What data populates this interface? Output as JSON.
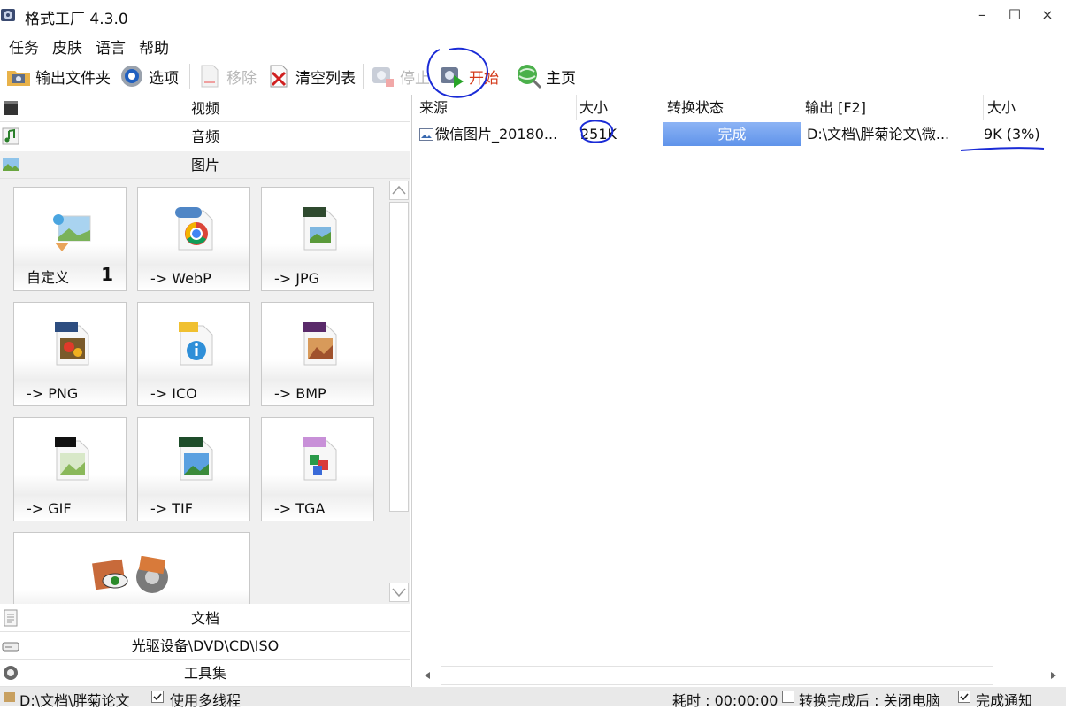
{
  "window": {
    "title": "格式工厂 4.3.0",
    "minimize": "–",
    "maximize": "☐",
    "close": "×"
  },
  "menu": [
    "任务",
    "皮肤",
    "语言",
    "帮助"
  ],
  "toolbar": {
    "output_folder": "输出文件夹",
    "options": "选项",
    "remove": "移除",
    "clear_list": "清空列表",
    "stop": "停止",
    "start": "开始",
    "home": "主页"
  },
  "categories": {
    "video": "视频",
    "audio": "音频",
    "image": "图片",
    "document": "文档",
    "dvd": "光驱设备\\DVD\\CD\\ISO",
    "tools": "工具集"
  },
  "image_tiles": [
    {
      "label": "自定义",
      "badge": "1",
      "icon": "custom-image-icon"
    },
    {
      "label": "-> WebP",
      "icon": "webp-icon",
      "tag": "WebP"
    },
    {
      "label": "-> JPG",
      "icon": "jpg-icon",
      "tag": "JPG"
    },
    {
      "label": "-> PNG",
      "icon": "png-icon",
      "tag": "PNG"
    },
    {
      "label": "-> ICO",
      "icon": "ico-icon",
      "tag": "ICO"
    },
    {
      "label": "-> BMP",
      "icon": "bmp-icon",
      "tag": "BMP"
    },
    {
      "label": "-> GIF",
      "icon": "gif-icon",
      "tag": "GIF"
    },
    {
      "label": "-> TIF",
      "icon": "tif-icon",
      "tag": "TIFF"
    },
    {
      "label": "-> TGA",
      "icon": "tga-icon",
      "tag": "TGA"
    },
    {
      "label": "",
      "icon": "image-tools-icon"
    }
  ],
  "table": {
    "headers": [
      "来源",
      "大小",
      "转换状态",
      "输出 [F2]",
      "大小"
    ],
    "rows": [
      {
        "source": "微信图片_20180...",
        "size": "251K",
        "status": "完成",
        "output": "D:\\文档\\胖菊论文\\微...",
        "out_size": "9K  (3%)"
      }
    ]
  },
  "statusbar": {
    "path": "D:\\文档\\胖菊论文",
    "multithread": "使用多线程",
    "elapsed": "耗时 : 00:00:00",
    "after_done": "转换完成后 : 关闭电脑",
    "notify": "完成通知"
  },
  "colors": {
    "status_done": "#6f9cee",
    "annotation": "#1a2bd6",
    "start_text": "#d43a1a"
  }
}
